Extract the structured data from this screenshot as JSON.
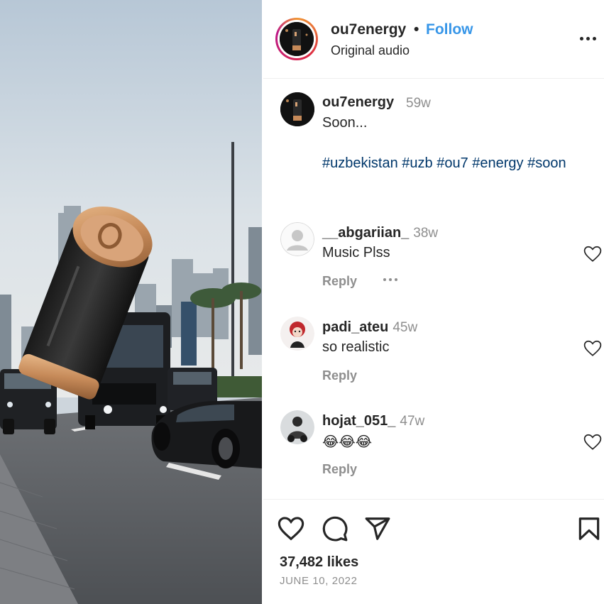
{
  "post": {
    "media_alt": "",
    "owner": {
      "username": "ou7energy",
      "separator": "•",
      "follow_label": "Follow",
      "audio": "Original audio"
    },
    "caption": {
      "username": "ou7energy",
      "time": "59w",
      "text": "Soon...",
      "hashtags": "#uzbekistan #uzb #ou7 #energy #soon"
    },
    "comments": [
      {
        "username": "__abgariian_",
        "time": "38w",
        "text": "Music Plss",
        "reply_label": "Reply",
        "has_more": true,
        "avatar": "default-avatar"
      },
      {
        "username": "padi_ateu",
        "time": "45w",
        "text": "so realistic",
        "reply_label": "Reply",
        "has_more": false,
        "avatar": "anime-avatar"
      },
      {
        "username": "hojat_051_",
        "time": "47w",
        "text": "😂😂😂",
        "reply_label": "Reply",
        "has_more": false,
        "avatar": "photo-avatar"
      }
    ],
    "likes": "37,482 likes",
    "date": "JUNE 10, 2022"
  },
  "colors": {
    "follow": "#3796e8",
    "hashtag": "#00376b",
    "muted": "#8e8e8e",
    "text": "#262626"
  },
  "icons": [
    "more-icon",
    "heart-icon",
    "comment-icon",
    "share-icon",
    "bookmark-icon"
  ]
}
